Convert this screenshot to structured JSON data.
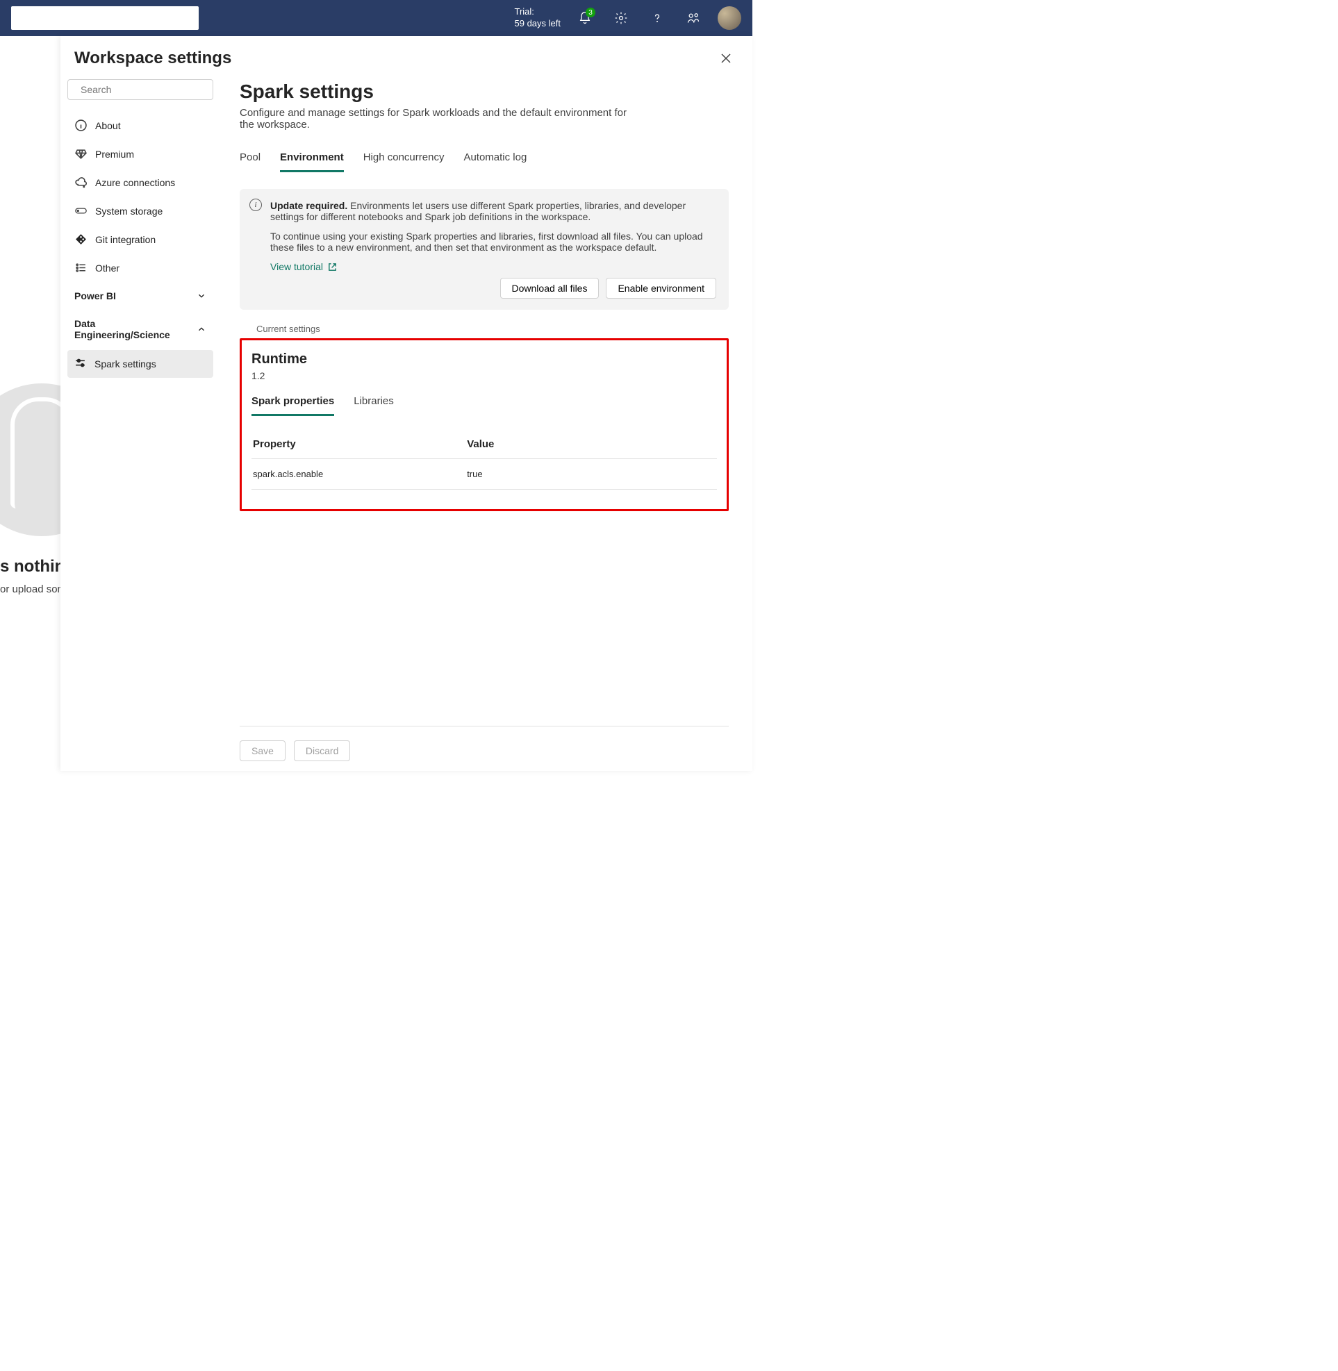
{
  "topbar": {
    "trial_label": "Trial:",
    "trial_days": "59 days left",
    "notification_count": "3"
  },
  "panel": {
    "title": "Workspace settings",
    "search_placeholder": "Search"
  },
  "sidebar": {
    "items": [
      {
        "label": "About"
      },
      {
        "label": "Premium"
      },
      {
        "label": "Azure connections"
      },
      {
        "label": "System storage"
      },
      {
        "label": "Git integration"
      },
      {
        "label": "Other"
      }
    ],
    "groups": [
      {
        "label": "Power BI",
        "expanded": false
      },
      {
        "label": "Data Engineering/Science",
        "expanded": true,
        "children": [
          {
            "label": "Spark settings"
          }
        ]
      }
    ]
  },
  "main": {
    "title": "Spark settings",
    "subtitle": "Configure and manage settings for Spark workloads and the default environment for the workspace.",
    "tabs": [
      "Pool",
      "Environment",
      "High concurrency",
      "Automatic log"
    ],
    "active_tab": "Environment",
    "notice": {
      "title": "Update required.",
      "body1": "Environments let users use different Spark properties, libraries, and developer settings for different notebooks and Spark job definitions in the workspace.",
      "body2": "To continue using your existing Spark properties and libraries, first download all files. You can upload these files to a new environment, and then set that environment as the workspace default.",
      "tutorial_link": "View tutorial",
      "download_btn": "Download all files",
      "enable_btn": "Enable environment"
    },
    "current_label": "Current settings",
    "runtime": {
      "title": "Runtime",
      "version": "1.2",
      "subtabs": [
        "Spark properties",
        "Libraries"
      ],
      "active_subtab": "Spark properties",
      "columns": [
        "Property",
        "Value"
      ],
      "rows": [
        {
          "property": "spark.acls.enable",
          "value": "true"
        }
      ]
    },
    "footer": {
      "save": "Save",
      "discard": "Discard"
    }
  },
  "bg": {
    "heading": "s nothing",
    "text": "or upload som"
  }
}
